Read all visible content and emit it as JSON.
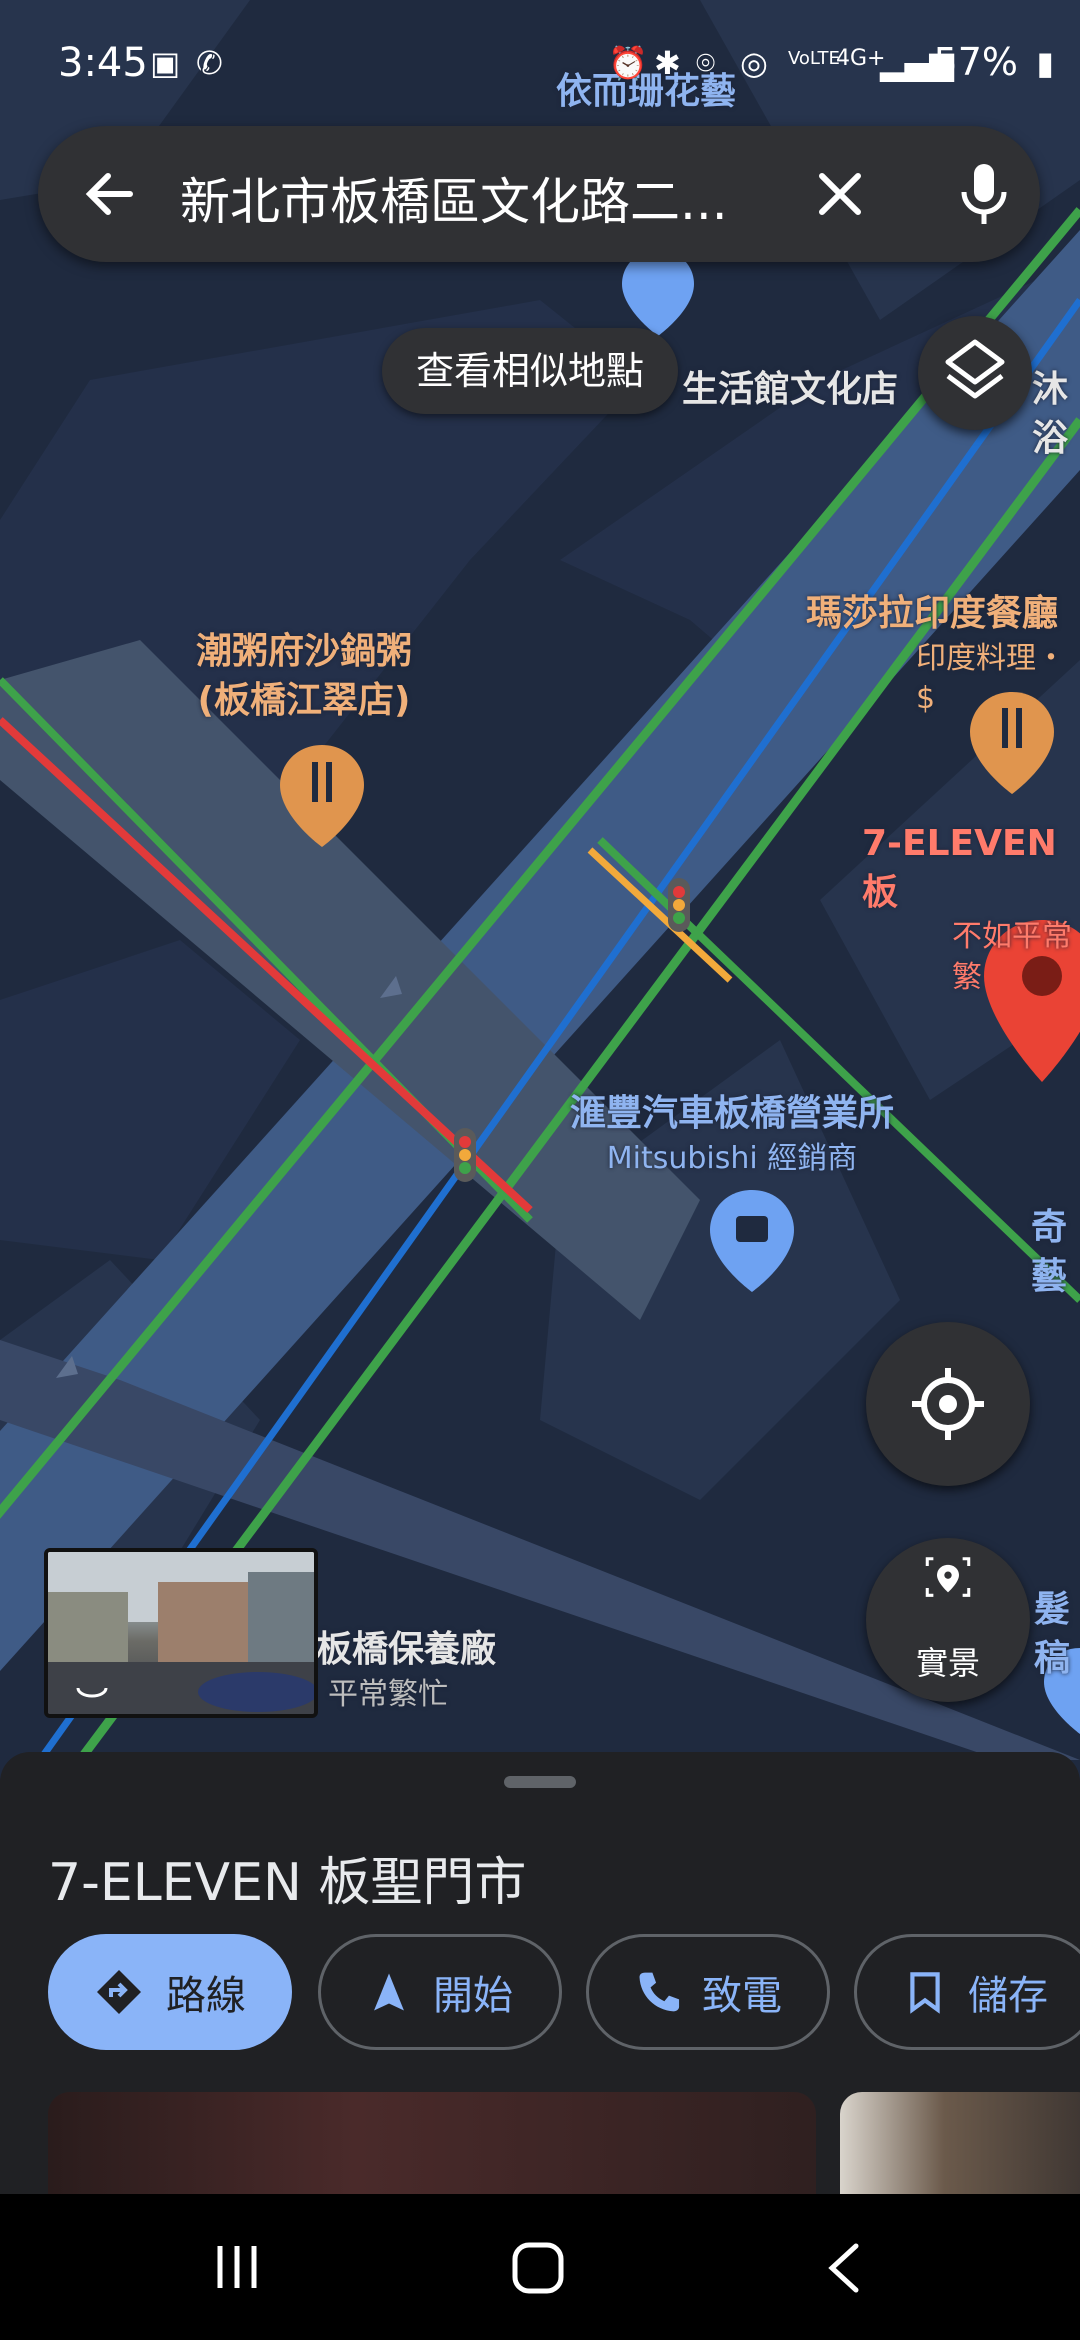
{
  "status_bar": {
    "time": "3:45",
    "battery": "57%",
    "network": "4G+"
  },
  "search": {
    "query": "新北市板橋區文化路二..."
  },
  "map": {
    "similar_places_button": "查看相似地點",
    "pois": {
      "top_label": "依而珊花藝",
      "store_partial": "生活館文化店",
      "store_partial2": "沐浴",
      "porridge_name": "潮粥府沙鍋粥",
      "porridge_branch": "(板橋江翠店)",
      "indian_name": "瑪莎拉印度餐廳",
      "indian_sub": "印度料理・$",
      "seven_name": "7-ELEVEN 板",
      "seven_sub": "不如平常繁",
      "mitsubishi_name": "滙豐汽車板橋營業所",
      "mitsubishi_sub": "Mitsubishi 經銷商",
      "right_partial": "奇藝",
      "right_partial2": "髮稿",
      "bottom_name": "板橋保養廠",
      "bottom_sub": "平常繁忙"
    },
    "live_view_label": "實景"
  },
  "sheet": {
    "title": "7-ELEVEN 板聖門市",
    "actions": [
      {
        "label": "路線",
        "icon": "directions-icon"
      },
      {
        "label": "開始",
        "icon": "navigation-arrow-icon"
      },
      {
        "label": "致電",
        "icon": "phone-icon"
      },
      {
        "label": "儲存",
        "icon": "bookmark-icon"
      }
    ]
  },
  "colors": {
    "map_background": "#1f2a3f",
    "accent": "#8ab4f8",
    "traffic_green": "#3ea24a",
    "traffic_red": "#e23a3a",
    "traffic_orange": "#f2a93b",
    "marker_red": "#ea4335"
  }
}
